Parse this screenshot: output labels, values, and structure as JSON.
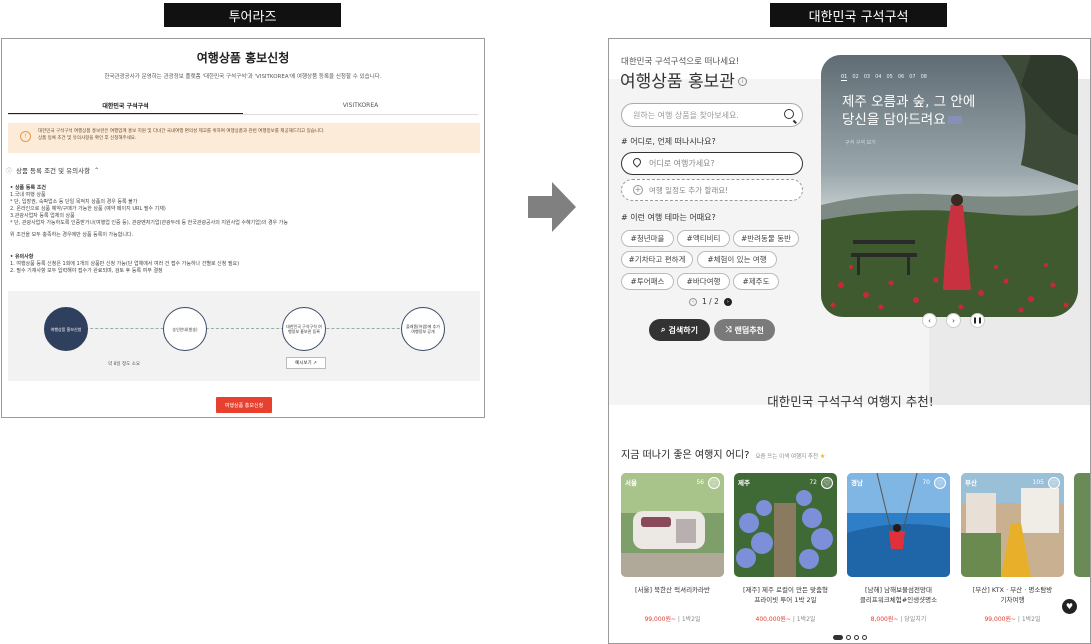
{
  "labels": {
    "left": "투어라즈",
    "right": "대한민국 구석구석"
  },
  "left": {
    "title": "여행상품 홍보신청",
    "subtitle": "한국관광공사가 운영하는 관광정보 플랫폼 '대한민국 구석구석'과 'VISITKOREA'에 여행상품 등록을 신청할 수 있습니다.",
    "tabs": [
      "대한민국 구석구석",
      "VISITKOREA"
    ],
    "notice_1": "대한민국 구석구석 여행상품 홍보란은 여행업계 홍보 지원 및 다녀간 국내여행 편의성 제고를 위하여 여행상품과 관련 여행정보를 제공해드리고 있습니다.",
    "notice_2": "상품 등록 조건 및 유의사항을 확인 후 신청해주세요.",
    "conditions_toggle": "상품 등록 조건 및 유의사항",
    "section1_title": "상품 등록 조건",
    "section1_lines": [
      "1.국내 여행 상품",
      "* 단, 입장권, 숙박업소 등 단일 목적지 상품의 경우 등록 불가",
      "2. 온라인으로 상품 예약/구매가 가능한 상품 (예약 페이지 URL 필수 기재)",
      "3.관광사업자 등록 업체의 상품",
      "* 단, 관광사업자 가능하도록 인증받거나(여행업 인증 등), 관광벤처기업(관광두레 등 한국관광공사의 지원사업 수혜기업)의 경우 가능"
    ],
    "section1_foot": "위 조건을 모두 충족하는 경우에만 상품 등록이 가능합니다.",
    "section2_title": "유의사항",
    "section2_lines": [
      "1. 여행상품 등록 신청은 1회에 1개의 상품만 신청 가능(단 업체에서 여러 건 접수 가능하나 건별로 신청 필요)",
      "2. 필수 기재사항 모두 입력해야 접수가 완료되며, 검토 후 등록 여부 결정"
    ],
    "flow_steps": [
      "여행상품 홍보신청",
      "승인안내(발송)",
      "대한민국 구석구석 여행정보 홍보관 등록",
      "플래폼(어썸)에 추가 여행정보 공개"
    ],
    "flow_note": "약 8일 정도 소요",
    "example_btn": "예시보기 ↗",
    "apply_btn": "여행상품 홍보신청"
  },
  "right": {
    "kicker": "대한민국 구석구석으로 떠나세요!",
    "title": "여행상품 홍보관",
    "search_placeholder": "원하는 여행 상품을 찾아보세요.",
    "q_when": "# 어디로, 언제 떠나시나요?",
    "dest_placeholder": "어디로 여행가세요?",
    "add_schedule": "여행 일정도 추가 할래요!",
    "q_theme": "# 이런 여행 테마는 어때요?",
    "chips": [
      "#청년마을",
      "#액티비티",
      "#반려동물 동반",
      "#기차타고 편하게",
      "#체험이 있는 여행",
      "#투어패스",
      "#바다여행",
      "#제주도"
    ],
    "pager": "1 / 2",
    "btn_search": "검색하기",
    "btn_random": "랜덤추천",
    "hero_steps": [
      "01",
      "02",
      "03",
      "04",
      "05",
      "06",
      "07",
      "08"
    ],
    "hero_line1": "제주 오름과 숲, 그 안에",
    "hero_line2": "당신을 담아드려요",
    "hero_sub": "구석 구석 보기",
    "rec_title": "대한민국 구석구석 여행지 추천!",
    "now_title": "지금 떠나기 좋은 여행지 어디?",
    "now_sub": "요즘 뜨는 이색 여행지 추천",
    "cards": [
      {
        "badge": "서울",
        "count": "56",
        "name1": "[서울] 북한산 럭셔리카라반",
        "name2": "",
        "price": "99,000원~",
        "meta": "1박2일"
      },
      {
        "badge": "제주",
        "count": "72",
        "name1": "[제주] 제주 로컬이 만든 맞춤형",
        "name2": "프라이빗 투어 1박 2일",
        "price": "400,000원~",
        "meta": "1박2일"
      },
      {
        "badge": "경남",
        "count": "70",
        "name1": "[남해] 남해보물섬전망대",
        "name2": "클리프워크체험#인생샷명소",
        "price": "8,000원~",
        "meta": "당일치기"
      },
      {
        "badge": "부산",
        "count": "105",
        "name1": "[부산] KTX · 부산 · 명소탐방",
        "name2": "기차여행",
        "price": "99,000원~",
        "meta": "1박2일"
      }
    ]
  }
}
